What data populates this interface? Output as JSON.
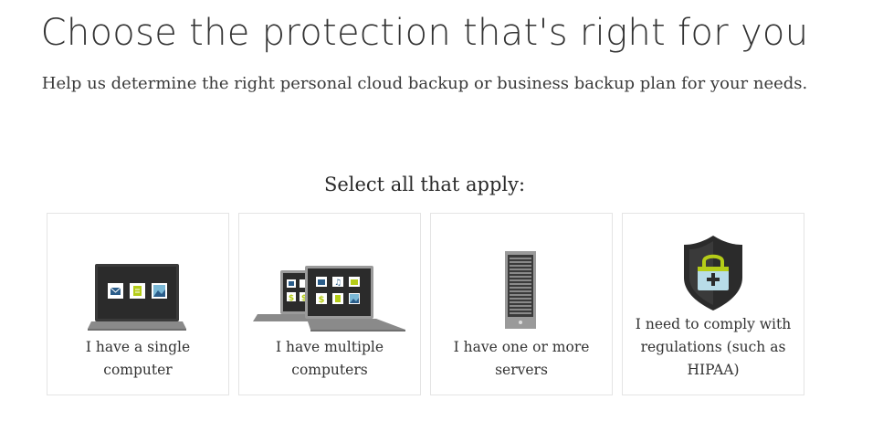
{
  "header": {
    "title": "Choose the protection that's right for you",
    "subtitle": "Help us determine the right personal cloud backup or business backup plan for your needs."
  },
  "selector": {
    "prompt": "Select all that apply:",
    "options": [
      {
        "label": "I have a single computer",
        "icon": "laptop-icon"
      },
      {
        "label": "I have multiple computers",
        "icon": "multiple-laptops-icon"
      },
      {
        "label": "I have one or more servers",
        "icon": "server-icon"
      },
      {
        "label": "I need to comply with regulations (such as HIPAA)",
        "icon": "shield-lock-icon"
      }
    ]
  },
  "colors": {
    "text": "#333333",
    "card_border": "#e4e4e4",
    "device_dark": "#2b2b2b",
    "device_gray": "#8a8a8a",
    "accent_green": "#b5cc18",
    "accent_blue": "#7ab8d6"
  }
}
